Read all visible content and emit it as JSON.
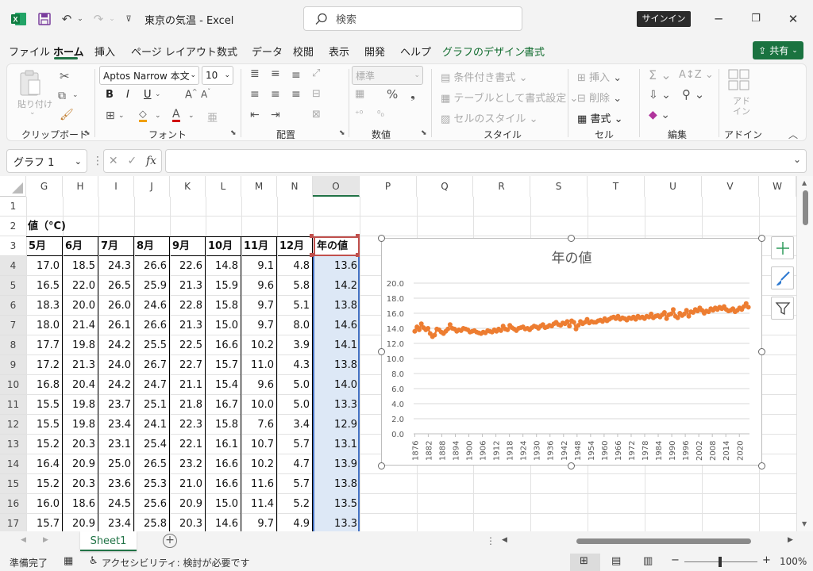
{
  "app": {
    "title": "東京の気温  -  Excel",
    "search_placeholder": "検索",
    "signin": "サインイン"
  },
  "menu": {
    "items": [
      "ファイル",
      "ホーム",
      "挿入",
      "ページ レイアウト",
      "数式",
      "データ",
      "校閲",
      "表示",
      "開発",
      "ヘルプ",
      "グラフのデザイン",
      "書式"
    ],
    "share": "共有"
  },
  "ribbon": {
    "clipboard": {
      "paste": "貼り付け",
      "label": "クリップボード"
    },
    "font": {
      "name": "Aptos Narrow 本文",
      "size": "10",
      "bold": "B",
      "italic": "I",
      "underline": "U",
      "label": "フォント"
    },
    "alignment": {
      "label": "配置"
    },
    "number": {
      "format": "標準",
      "label": "数値"
    },
    "styles": {
      "conditional": "条件付き書式",
      "table": "テーブルとして書式設定",
      "cell": "セルのスタイル",
      "label": "スタイル"
    },
    "cells": {
      "insert": "挿入",
      "delete": "削除",
      "format": "書式",
      "label": "セル"
    },
    "editing": {
      "label": "編集"
    },
    "addin": {
      "button": "アド\nイン",
      "label": "アドイン"
    }
  },
  "formula_bar": {
    "name_box": "グラフ 1",
    "fx": "fx",
    "content": ""
  },
  "columns": [
    "G",
    "H",
    "I",
    "J",
    "K",
    "L",
    "M",
    "N",
    "O",
    "P",
    "Q",
    "R",
    "S",
    "T",
    "U",
    "V",
    "W"
  ],
  "rows": [
    "1",
    "2",
    "3",
    "4",
    "5",
    "6",
    "7",
    "8",
    "9",
    "10",
    "11",
    "12",
    "13",
    "14",
    "15",
    "16",
    "17"
  ],
  "table": {
    "caption": "値（°C)",
    "headers": [
      "5月",
      "6月",
      "7月",
      "8月",
      "9月",
      "10月",
      "11月",
      "12月",
      "年の値"
    ],
    "data": [
      [
        "17.0",
        "18.5",
        "24.3",
        "26.6",
        "22.6",
        "14.8",
        "9.1",
        "4.8",
        "13.6"
      ],
      [
        "16.5",
        "22.0",
        "26.5",
        "25.9",
        "21.3",
        "15.9",
        "9.6",
        "5.8",
        "14.2"
      ],
      [
        "18.3",
        "20.0",
        "26.0",
        "24.6",
        "22.8",
        "15.8",
        "9.7",
        "5.1",
        "13.8"
      ],
      [
        "18.0",
        "21.4",
        "26.1",
        "26.6",
        "21.3",
        "15.0",
        "9.7",
        "8.0",
        "14.6"
      ],
      [
        "17.7",
        "19.8",
        "24.2",
        "25.5",
        "22.5",
        "16.6",
        "10.2",
        "3.9",
        "14.1"
      ],
      [
        "17.2",
        "21.3",
        "24.0",
        "26.7",
        "22.7",
        "15.7",
        "11.0",
        "4.3",
        "13.8"
      ],
      [
        "16.8",
        "20.4",
        "24.2",
        "24.7",
        "21.1",
        "15.4",
        "9.6",
        "5.0",
        "14.0"
      ],
      [
        "15.5",
        "19.8",
        "23.7",
        "25.1",
        "21.8",
        "16.7",
        "10.0",
        "5.0",
        "13.3"
      ],
      [
        "15.5",
        "19.8",
        "23.4",
        "24.1",
        "22.3",
        "15.8",
        "7.6",
        "3.4",
        "12.9"
      ],
      [
        "15.2",
        "20.3",
        "23.1",
        "25.4",
        "22.1",
        "16.1",
        "10.7",
        "5.7",
        "13.1"
      ],
      [
        "16.4",
        "20.9",
        "25.0",
        "26.5",
        "23.2",
        "16.6",
        "10.2",
        "4.7",
        "13.9"
      ],
      [
        "15.2",
        "20.3",
        "23.6",
        "25.3",
        "21.0",
        "16.6",
        "11.6",
        "5.7",
        "13.8"
      ],
      [
        "16.0",
        "18.6",
        "24.5",
        "25.6",
        "20.9",
        "15.0",
        "11.4",
        "5.2",
        "13.5"
      ],
      [
        "15.7",
        "20.9",
        "23.4",
        "25.8",
        "20.3",
        "14.6",
        "9.7",
        "4.9",
        "13.3"
      ]
    ]
  },
  "chart_data": {
    "type": "line",
    "title": "年の値",
    "xlabel": "",
    "ylabel": "",
    "ylim": [
      0,
      20
    ],
    "yticks": [
      "0.0",
      "2.0",
      "4.0",
      "6.0",
      "8.0",
      "10.0",
      "12.0",
      "14.0",
      "16.0",
      "18.0",
      "20.0"
    ],
    "xtick_labels": [
      "1876",
      "1882",
      "1888",
      "1894",
      "1900",
      "1906",
      "1912",
      "1918",
      "1924",
      "1930",
      "1936",
      "1942",
      "1948",
      "1954",
      "1960",
      "1966",
      "1972",
      "1978",
      "1984",
      "1990",
      "1996",
      "2002",
      "2008",
      "2014",
      "2020"
    ],
    "x_start": 1876,
    "x_end": 2024,
    "color": "#ed7d31",
    "grid": true,
    "series": [
      {
        "values": [
          13.6,
          14.2,
          13.8,
          14.6,
          14.1,
          13.8,
          14.0,
          13.3,
          12.9,
          13.1,
          13.9,
          13.8,
          13.5,
          13.3,
          13.6,
          13.9,
          14.5,
          14.0,
          13.9,
          13.6,
          13.8,
          13.7,
          14.0,
          13.9,
          13.8,
          13.5,
          13.6,
          13.7,
          13.5,
          13.4,
          13.3,
          13.5,
          13.4,
          13.7,
          13.6,
          13.5,
          13.8,
          13.6,
          13.9,
          13.7,
          14.3,
          13.9,
          13.8,
          14.4,
          14.1,
          13.9,
          13.7,
          14.0,
          14.1,
          14.2,
          13.9,
          14.0,
          13.8,
          14.1,
          14.3,
          14.2,
          14.0,
          14.3,
          14.5,
          14.1,
          14.2,
          14.4,
          14.3,
          14.6,
          14.8,
          14.5,
          14.4,
          14.7,
          14.6,
          14.9,
          14.3,
          15.0,
          14.8,
          13.9,
          14.4,
          14.9,
          14.6,
          14.8,
          15.2,
          14.7,
          14.9,
          14.8,
          14.8,
          15.0,
          15.1,
          14.9,
          15.3,
          15.0,
          15.2,
          15.4,
          15.5,
          15.3,
          15.6,
          15.2,
          15.4,
          15.3,
          15.1,
          15.4,
          15.3,
          15.5,
          15.2,
          15.6,
          15.4,
          15.5,
          15.3,
          15.6,
          15.5,
          15.9,
          15.4,
          15.6,
          15.7,
          15.5,
          15.8,
          16.1,
          15.3,
          15.8,
          15.9,
          16.5,
          15.6,
          15.4,
          16.0,
          15.7,
          15.9,
          16.4,
          15.6,
          16.2,
          16.1,
          16.5,
          16.3,
          16.7,
          16.4,
          16.0,
          16.3,
          16.2,
          16.6,
          16.4,
          16.7,
          16.5,
          16.8,
          16.6,
          16.9,
          16.5,
          16.3,
          16.4,
          16.6,
          16.2,
          16.4,
          16.7,
          16.5,
          16.9,
          17.3,
          16.8
        ]
      }
    ]
  },
  "sheet": {
    "tab": "Sheet1"
  },
  "status": {
    "ready": "準備完了",
    "accessibility": "アクセシビリティ: 検討が必要です",
    "zoom": "100%"
  }
}
